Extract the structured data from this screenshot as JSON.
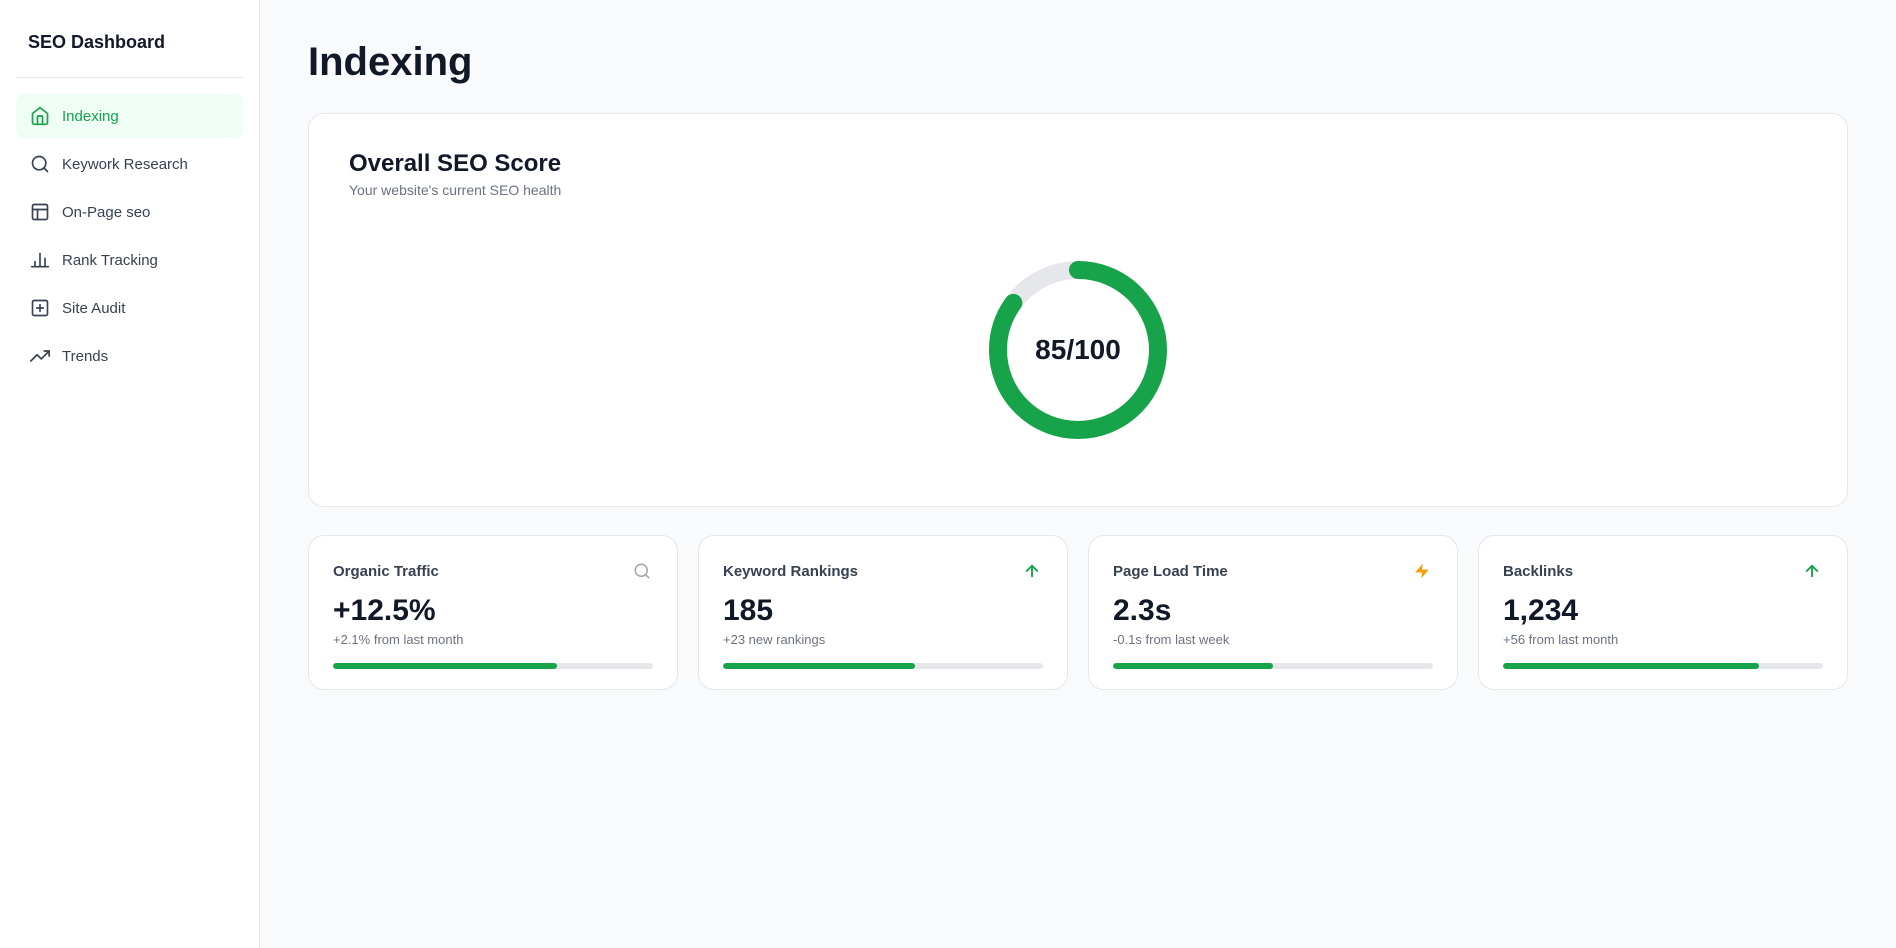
{
  "sidebar": {
    "title": "SEO Dashboard",
    "items": [
      {
        "id": "indexing",
        "label": "Indexing",
        "icon": "home",
        "active": true
      },
      {
        "id": "keyword-research",
        "label": "Keywork Research",
        "icon": "search",
        "active": false
      },
      {
        "id": "on-page-seo",
        "label": "On-Page seo",
        "icon": "document",
        "active": false
      },
      {
        "id": "rank-tracking",
        "label": "Rank Tracking",
        "icon": "chart-bar",
        "active": false
      },
      {
        "id": "site-audit",
        "label": "Site Audit",
        "icon": "plus-square",
        "active": false
      },
      {
        "id": "trends",
        "label": "Trends",
        "icon": "trending-up",
        "active": false
      }
    ]
  },
  "page": {
    "title": "Indexing"
  },
  "seo_score_card": {
    "title": "Overall SEO Score",
    "subtitle": "Your website's current SEO health",
    "score": "85/100",
    "score_value": 85,
    "score_max": 100
  },
  "metrics": [
    {
      "name": "Organic Traffic",
      "icon_type": "search",
      "icon_color": "gray",
      "value": "+12.5%",
      "change": "+2.1% from last month",
      "bar_pct": 70
    },
    {
      "name": "Keyword Rankings",
      "icon_type": "arrow-up",
      "icon_color": "green",
      "value": "185",
      "change": "+23 new rankings",
      "bar_pct": 60
    },
    {
      "name": "Page Load Time",
      "icon_type": "bolt",
      "icon_color": "yellow",
      "value": "2.3s",
      "change": "-0.1s from last week",
      "bar_pct": 50
    },
    {
      "name": "Backlinks",
      "icon_type": "arrow-up",
      "icon_color": "green",
      "value": "1,234",
      "change": "+56 from last month",
      "bar_pct": 80
    }
  ]
}
